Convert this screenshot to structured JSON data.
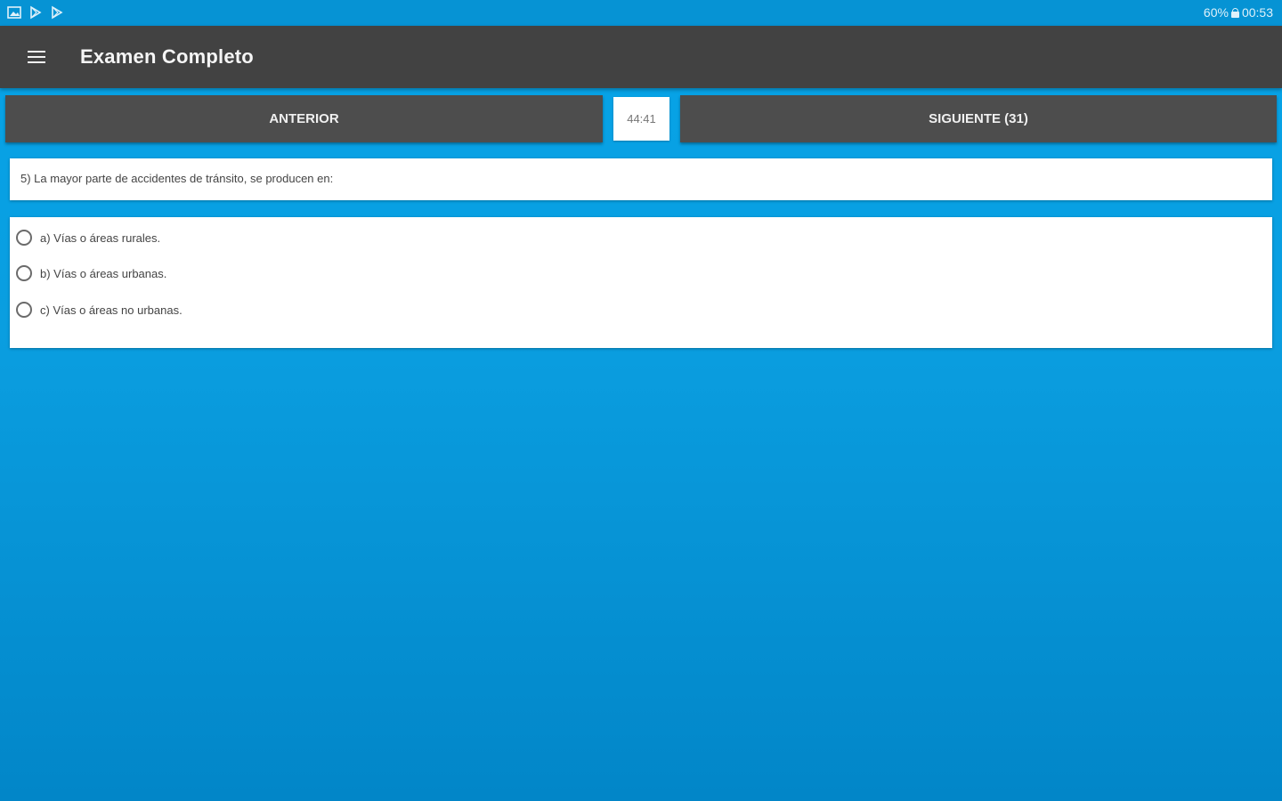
{
  "status_bar": {
    "left_icons": [
      "gallery-icon",
      "play-store-icon",
      "play-store-icon"
    ],
    "battery": "60%",
    "time": "00:53"
  },
  "app_bar": {
    "title": "Examen Completo",
    "menu_icon": "hamburger-menu-icon"
  },
  "navigation": {
    "previous_label": "ANTERIOR",
    "timer": "44:41",
    "next_label": "SIGUIENTE (31)"
  },
  "question": {
    "text": "5) La mayor parte de accidentes de tránsito, se producen en:"
  },
  "options": [
    {
      "label": "a) Vías o áreas rurales."
    },
    {
      "label": "b) Vías o áreas urbanas."
    },
    {
      "label": "c) Vías o áreas no urbanas."
    }
  ],
  "colors": {
    "background": "#06a4e8",
    "status_bar": "#0693d4",
    "app_bar": "#424242",
    "nav_button": "#4d4d4d"
  }
}
